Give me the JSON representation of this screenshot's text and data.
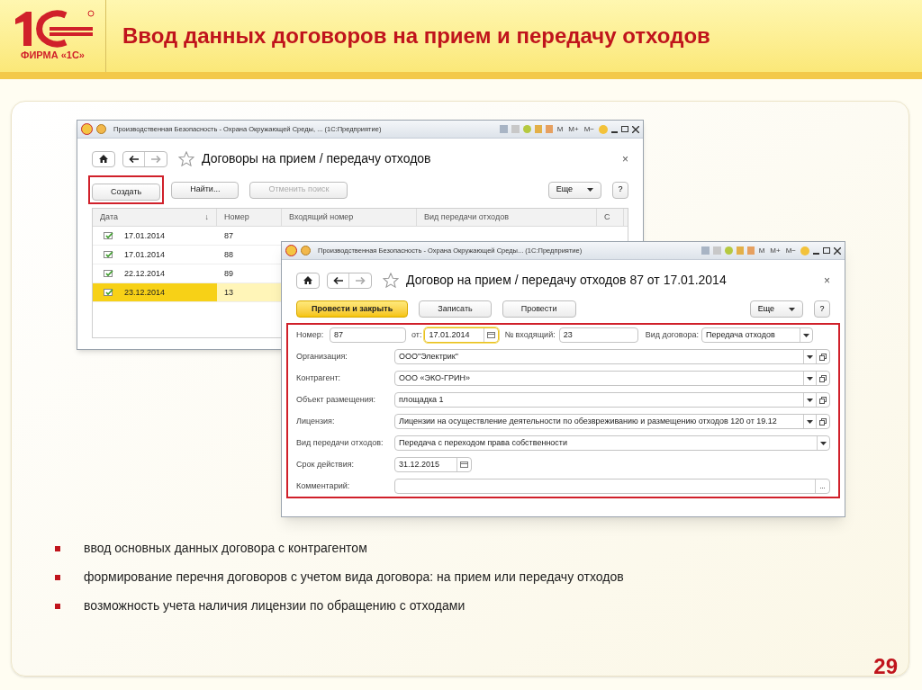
{
  "header": {
    "logo_caption": "ФИРМА «1С»",
    "title": "Ввод данных договоров на прием и передачу отходов"
  },
  "list_window": {
    "title": "Производственная Безопасность - Охрана Окружающей Среды, ...  (1С:Предприятие)",
    "memory_buttons": [
      "M",
      "M+",
      "M−"
    ],
    "heading": "Договоры на прием / передачу отходов",
    "close": "×",
    "buttons": [
      {
        "label": "Создать",
        "disabled": false,
        "highlighted": true
      },
      {
        "label": "Найти...",
        "disabled": false,
        "highlighted": false
      },
      {
        "label": "Отменить поиск",
        "disabled": true,
        "highlighted": false
      }
    ],
    "more_button": "Еще",
    "help_button": "?",
    "columns": [
      "Дата",
      "Номер",
      "Входящий номер",
      "Вид передачи отходов",
      "С"
    ],
    "sort_mark": "↓",
    "rows": [
      {
        "date": "17.01.2014",
        "number": "87",
        "selected": false
      },
      {
        "date": "17.01.2014",
        "number": "88",
        "selected": false
      },
      {
        "date": "22.12.2014",
        "number": "89",
        "selected": false
      },
      {
        "date": "23.12.2014",
        "number": "13",
        "selected": true
      }
    ]
  },
  "form_window": {
    "title": "Производственная Безопасность - Охрана Окружающей Среды...  (1С:Предприятие)",
    "memory_buttons": [
      "M",
      "M+",
      "M−"
    ],
    "heading": "Договор на прием / передачу отходов 87 от 17.01.2014",
    "close": "×",
    "buttons": [
      {
        "label": "Провести и закрыть",
        "kind": "primary"
      },
      {
        "label": "Записать",
        "kind": "normal"
      },
      {
        "label": "Провести",
        "kind": "normal"
      }
    ],
    "more_button": "Еще",
    "help_button": "?",
    "fields_highlighted": true,
    "top_row": {
      "number_label": "Номер:",
      "number": "87",
      "date_label": "от:",
      "date": "17.01.2014",
      "date_focused": true,
      "incoming_label": "№ входящий:",
      "incoming": "23",
      "type_label": "Вид договора:",
      "type": "Передача отходов"
    },
    "fields": [
      {
        "label": "Организация:",
        "value": "ООО\"Электрик\"",
        "kind": "reference"
      },
      {
        "label": "Контрагент:",
        "value": "ООО «ЭКО-ГРИН»",
        "kind": "reference"
      },
      {
        "label": "Объект размещения:",
        "value": "площадка 1",
        "kind": "reference"
      },
      {
        "label": "Лицензия:",
        "value": "Лицензии на осуществление деятельности по обезвреживанию и размещению отходов 120 от 19.12",
        "kind": "reference"
      },
      {
        "label": "Вид передачи отходов:",
        "value": "Передача с переходом права собственности",
        "kind": "select"
      },
      {
        "label": "Срок действия:",
        "value": "31.12.2015",
        "kind": "date"
      },
      {
        "label": "Комментарий:",
        "kind": "text",
        "button": "..."
      }
    ]
  },
  "bullets": [
    "ввод основных данных договора с контрагентом",
    "формирование перечня договоров с учетом вида договора: на прием или передачу отходов",
    "возможность учета наличия лицензии по обращению с отходами"
  ],
  "page_number": "29"
}
